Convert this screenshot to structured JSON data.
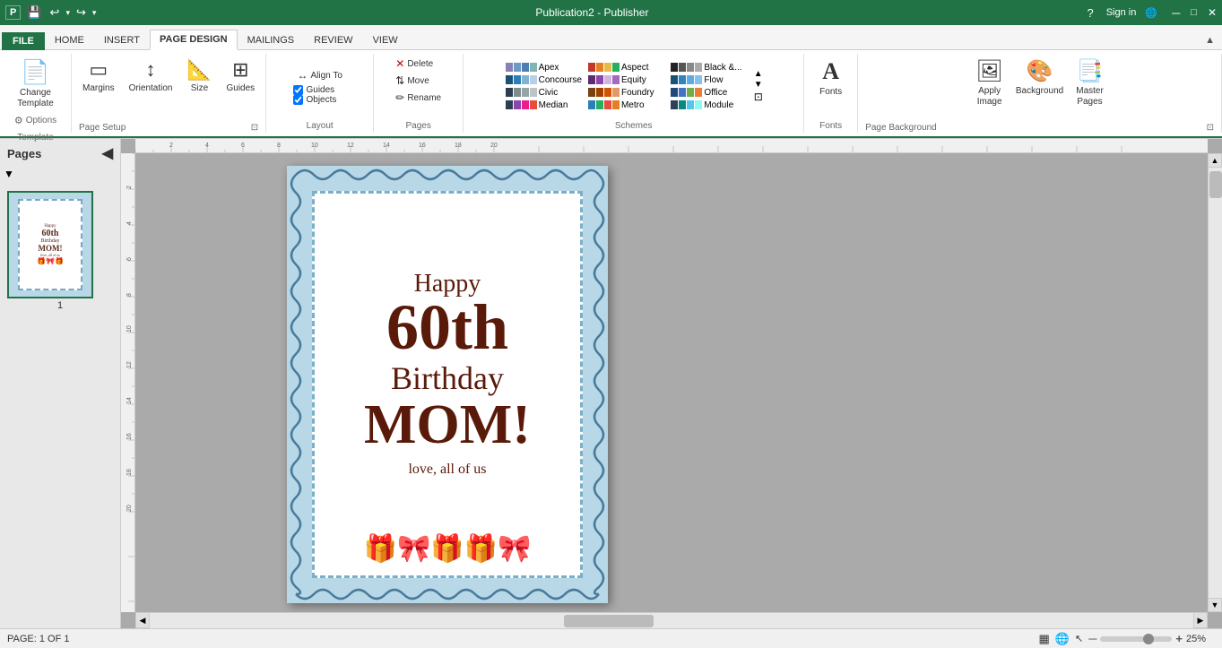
{
  "window": {
    "title": "Publication2 - Publisher",
    "help_icon": "?",
    "minimize": "─",
    "maximize": "□",
    "close": "✕"
  },
  "qat": {
    "save_label": "💾",
    "undo_label": "↩",
    "undo_arrow": "▾",
    "redo_label": "↪",
    "customize": "▾"
  },
  "tabs": [
    {
      "id": "file",
      "label": "FILE",
      "type": "file"
    },
    {
      "id": "home",
      "label": "HOME"
    },
    {
      "id": "insert",
      "label": "INSERT"
    },
    {
      "id": "page-design",
      "label": "PAGE DESIGN",
      "active": true
    },
    {
      "id": "mailings",
      "label": "MAILINGS"
    },
    {
      "id": "review",
      "label": "REVIEW"
    },
    {
      "id": "view",
      "label": "VIEW"
    }
  ],
  "ribbon": {
    "groups": {
      "template": {
        "label": "Template",
        "change_label": "Change\nTemplate",
        "options_label": "Options"
      },
      "page_setup": {
        "label": "Page Setup",
        "margins_label": "Margins",
        "orientation_label": "Orientation",
        "size_label": "Size",
        "guides_label": "Guides",
        "expand_icon": "⊡"
      },
      "layout": {
        "label": "Layout",
        "align_to": "Align To",
        "guides": "Guides",
        "objects": "Objects"
      },
      "pages": {
        "label": "Pages",
        "delete_label": "Delete",
        "move_label": "Move",
        "rename_label": "Rename"
      },
      "schemes": {
        "label": "Schemes",
        "items": [
          {
            "name": "Apex",
            "swatches": [
              "#8b7fb8",
              "#6b9ac4",
              "#4d7fb5",
              "#7fb5b5",
              "#c4a45a"
            ]
          },
          {
            "name": "Aspect",
            "swatches": [
              "#c0392b",
              "#e67e22",
              "#e7b94c",
              "#27ae60",
              "#2980b9"
            ]
          },
          {
            "name": "Black &...",
            "swatches": [
              "#222",
              "#555",
              "#888",
              "#aaa",
              "#ccc"
            ]
          },
          {
            "name": "Concourse",
            "swatches": [
              "#1a5276",
              "#2980b9",
              "#7fb3d0",
              "#b8cfe8",
              "#e8f0f8"
            ]
          },
          {
            "name": "Equity",
            "swatches": [
              "#5b2c6f",
              "#8e44ad",
              "#d2b4de",
              "#f5eef8",
              "#a569bd"
            ]
          },
          {
            "name": "Flow",
            "swatches": [
              "#1a5276",
              "#2e86c1",
              "#5dade2",
              "#85c1e9",
              "#aed6f1"
            ]
          },
          {
            "name": "Civic",
            "swatches": [
              "#2c3e50",
              "#7f8c8d",
              "#95a5a6",
              "#bdc3c7",
              "#ecf0f1"
            ]
          },
          {
            "name": "Foundry",
            "swatches": [
              "#784212",
              "#a04000",
              "#d35400",
              "#e59866",
              "#fde8d8"
            ]
          },
          {
            "name": "Office",
            "swatches": [
              "#1f497d",
              "#4472c4",
              "#70ad47",
              "#ed7d31",
              "#ffc000"
            ]
          },
          {
            "name": "Median",
            "swatches": [
              "#2c3e50",
              "#8e44ad",
              "#e91e8c",
              "#e74c3c",
              "#f39c12"
            ]
          },
          {
            "name": "Metro",
            "swatches": [
              "#2980b9",
              "#27ae60",
              "#e74c3c",
              "#e67e22",
              "#9b59b6"
            ]
          },
          {
            "name": "Module",
            "swatches": [
              "#2e4057",
              "#048a81",
              "#54c6eb",
              "#8ef9f3",
              "#cef9f2"
            ]
          }
        ]
      },
      "fonts": {
        "label": "Fonts",
        "fonts_label": "Fonts"
      },
      "page_background": {
        "label": "Page Background",
        "apply_image_label": "Apply\nImage",
        "background_label": "Background",
        "master_pages_label": "Master\nPages",
        "expand_icon": "⊡"
      }
    }
  },
  "pages_panel": {
    "title": "Pages",
    "page_number": "1",
    "collapse_icon": "◀"
  },
  "status_bar": {
    "page_info": "PAGE: 1 OF 1",
    "layout_icon": "▦",
    "view_icon": "👁",
    "zoom_minus": "─",
    "zoom_level": "25%",
    "zoom_plus": "+"
  },
  "card": {
    "text_happy": "Happy",
    "text_60th": "60th",
    "text_birthday": "Birthday",
    "text_mom": "MOM!",
    "text_love": "love, all of us",
    "gifts_emoji": "🎁🎀🎁🎁🎀"
  },
  "signin": {
    "label": "Sign in"
  }
}
